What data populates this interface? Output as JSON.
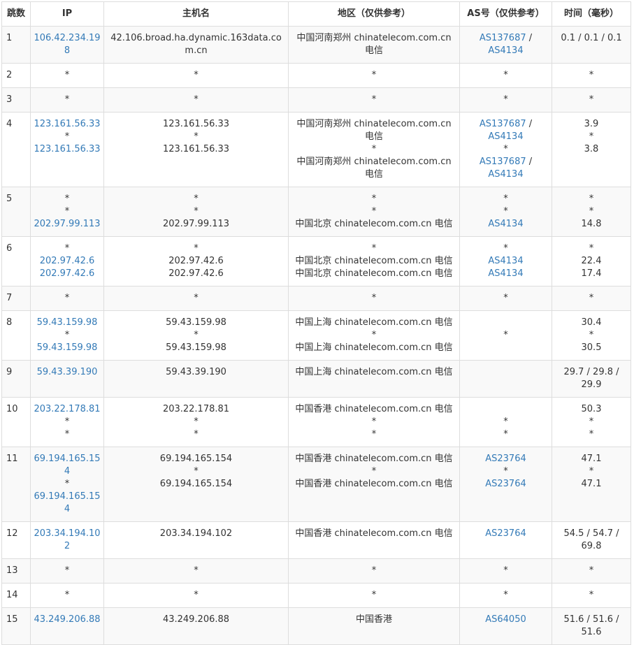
{
  "headers": {
    "hop": "跳数",
    "ip": "IP",
    "host": "主机名",
    "region": "地区（仅供参考）",
    "as": "AS号（仅供参考）",
    "time": "时间（毫秒）"
  },
  "link_color": "#337ab7",
  "rows": [
    {
      "hop": "1",
      "ip": [
        {
          "text": "106.42.234.198",
          "link": true
        }
      ],
      "host": [
        "42.106.broad.ha.dynamic.163data.com.cn"
      ],
      "region": [
        "中国河南郑州 chinatelecom.com.cn 电信"
      ],
      "as": [
        [
          {
            "text": "AS137687",
            "link": true
          },
          {
            "text": " / ",
            "link": false
          },
          {
            "text": "AS4134",
            "link": true
          }
        ]
      ],
      "time": [
        "0.1 / 0.1 / 0.1"
      ]
    },
    {
      "hop": "2",
      "ip": [
        {
          "text": "*",
          "link": false
        }
      ],
      "host": [
        "*"
      ],
      "region": [
        "*"
      ],
      "as": [
        [
          {
            "text": "*",
            "link": false
          }
        ]
      ],
      "time": [
        "*"
      ]
    },
    {
      "hop": "3",
      "ip": [
        {
          "text": "*",
          "link": false
        }
      ],
      "host": [
        "*"
      ],
      "region": [
        "*"
      ],
      "as": [
        [
          {
            "text": "*",
            "link": false
          }
        ]
      ],
      "time": [
        "*"
      ]
    },
    {
      "hop": "4",
      "ip": [
        {
          "text": "123.161.56.33",
          "link": true
        },
        {
          "text": "*",
          "link": false
        },
        {
          "text": "123.161.56.33",
          "link": true
        }
      ],
      "host": [
        "123.161.56.33",
        "*",
        "123.161.56.33"
      ],
      "region": [
        "中国河南郑州 chinatelecom.com.cn 电信",
        "*",
        "中国河南郑州 chinatelecom.com.cn 电信"
      ],
      "as": [
        [
          {
            "text": "AS137687",
            "link": true
          },
          {
            "text": " / ",
            "link": false
          },
          {
            "text": "AS4134",
            "link": true
          }
        ],
        [
          {
            "text": "*",
            "link": false
          }
        ],
        [
          {
            "text": "AS137687",
            "link": true
          },
          {
            "text": " / ",
            "link": false
          },
          {
            "text": "AS4134",
            "link": true
          }
        ]
      ],
      "time": [
        "3.9",
        "*",
        "3.8"
      ]
    },
    {
      "hop": "5",
      "ip": [
        {
          "text": "*",
          "link": false
        },
        {
          "text": "*",
          "link": false
        },
        {
          "text": "202.97.99.113",
          "link": true
        }
      ],
      "host": [
        "*",
        "*",
        "202.97.99.113"
      ],
      "region": [
        "*",
        "*",
        "中国北京 chinatelecom.com.cn 电信"
      ],
      "as": [
        [
          {
            "text": "*",
            "link": false
          }
        ],
        [
          {
            "text": "*",
            "link": false
          }
        ],
        [
          {
            "text": "AS4134",
            "link": true
          }
        ]
      ],
      "time": [
        "*",
        "*",
        "14.8"
      ]
    },
    {
      "hop": "6",
      "ip": [
        {
          "text": "*",
          "link": false
        },
        {
          "text": "202.97.42.6",
          "link": true
        },
        {
          "text": "202.97.42.6",
          "link": true
        }
      ],
      "host": [
        "*",
        "202.97.42.6",
        "202.97.42.6"
      ],
      "region": [
        "*",
        "中国北京 chinatelecom.com.cn 电信",
        "中国北京 chinatelecom.com.cn 电信"
      ],
      "as": [
        [
          {
            "text": "*",
            "link": false
          }
        ],
        [
          {
            "text": "AS4134",
            "link": true
          }
        ],
        [
          {
            "text": "AS4134",
            "link": true
          }
        ]
      ],
      "time": [
        "*",
        "22.4",
        "17.4"
      ]
    },
    {
      "hop": "7",
      "ip": [
        {
          "text": "*",
          "link": false
        }
      ],
      "host": [
        "*"
      ],
      "region": [
        "*"
      ],
      "as": [
        [
          {
            "text": "*",
            "link": false
          }
        ]
      ],
      "time": [
        "*"
      ]
    },
    {
      "hop": "8",
      "ip": [
        {
          "text": "59.43.159.98",
          "link": true
        },
        {
          "text": "*",
          "link": false
        },
        {
          "text": "59.43.159.98",
          "link": true
        }
      ],
      "host": [
        "59.43.159.98",
        "*",
        "59.43.159.98"
      ],
      "region": [
        "中国上海 chinatelecom.com.cn 电信",
        "*",
        "中国上海 chinatelecom.com.cn 电信"
      ],
      "as": [
        [
          {
            "text": "",
            "link": false
          }
        ],
        [
          {
            "text": "*",
            "link": false
          }
        ],
        [
          {
            "text": "",
            "link": false
          }
        ]
      ],
      "time": [
        "30.4",
        "*",
        "30.5"
      ]
    },
    {
      "hop": "9",
      "ip": [
        {
          "text": "59.43.39.190",
          "link": true
        }
      ],
      "host": [
        "59.43.39.190"
      ],
      "region": [
        "中国上海 chinatelecom.com.cn 电信"
      ],
      "as": [
        [
          {
            "text": "",
            "link": false
          }
        ]
      ],
      "time": [
        "29.7 / 29.8 / 29.9"
      ]
    },
    {
      "hop": "10",
      "ip": [
        {
          "text": "203.22.178.81",
          "link": true
        },
        {
          "text": "*",
          "link": false
        },
        {
          "text": "*",
          "link": false
        }
      ],
      "host": [
        "203.22.178.81",
        "*",
        "*"
      ],
      "region": [
        "中国香港 chinatelecom.com.cn 电信",
        "*",
        "*"
      ],
      "as": [
        [
          {
            "text": "",
            "link": false
          }
        ],
        [
          {
            "text": "*",
            "link": false
          }
        ],
        [
          {
            "text": "*",
            "link": false
          }
        ]
      ],
      "time": [
        "50.3",
        "*",
        "*"
      ]
    },
    {
      "hop": "11",
      "ip": [
        {
          "text": "69.194.165.154",
          "link": true
        },
        {
          "text": "*",
          "link": false
        },
        {
          "text": "69.194.165.154",
          "link": true
        }
      ],
      "host": [
        "69.194.165.154",
        "*",
        "69.194.165.154"
      ],
      "region": [
        "中国香港 chinatelecom.com.cn 电信",
        "*",
        "中国香港 chinatelecom.com.cn 电信"
      ],
      "as": [
        [
          {
            "text": "AS23764",
            "link": true
          }
        ],
        [
          {
            "text": "*",
            "link": false
          }
        ],
        [
          {
            "text": "AS23764",
            "link": true
          }
        ]
      ],
      "time": [
        "47.1",
        "*",
        "47.1"
      ]
    },
    {
      "hop": "12",
      "ip": [
        {
          "text": "203.34.194.102",
          "link": true
        }
      ],
      "host": [
        "203.34.194.102"
      ],
      "region": [
        "中国香港 chinatelecom.com.cn 电信"
      ],
      "as": [
        [
          {
            "text": "AS23764",
            "link": true
          }
        ]
      ],
      "time": [
        "54.5 / 54.7 / 69.8"
      ]
    },
    {
      "hop": "13",
      "ip": [
        {
          "text": "*",
          "link": false
        }
      ],
      "host": [
        "*"
      ],
      "region": [
        "*"
      ],
      "as": [
        [
          {
            "text": "*",
            "link": false
          }
        ]
      ],
      "time": [
        "*"
      ]
    },
    {
      "hop": "14",
      "ip": [
        {
          "text": "*",
          "link": false
        }
      ],
      "host": [
        "*"
      ],
      "region": [
        "*"
      ],
      "as": [
        [
          {
            "text": "*",
            "link": false
          }
        ]
      ],
      "time": [
        "*"
      ]
    },
    {
      "hop": "15",
      "ip": [
        {
          "text": "43.249.206.88",
          "link": true
        }
      ],
      "host": [
        "43.249.206.88"
      ],
      "region": [
        "中国香港"
      ],
      "as": [
        [
          {
            "text": "AS64050",
            "link": true
          }
        ]
      ],
      "time": [
        "51.6 / 51.6 / 51.6"
      ]
    }
  ]
}
